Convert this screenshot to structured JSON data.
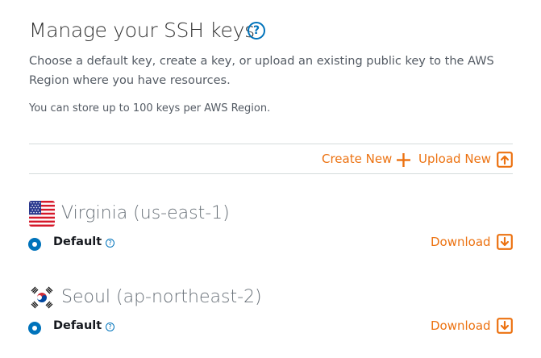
{
  "header": {
    "title": "Manage your SSH keys",
    "help_glyph": "?",
    "description": "Choose a default key, create a key, or upload an existing public key to the AWS Region where you have resources.",
    "note": "You can store up to 100 keys per AWS Region."
  },
  "actions": {
    "create_new_label": "Create New",
    "create_icon": "plus-icon",
    "upload_new_label": "Upload New",
    "upload_icon": "upload-icon"
  },
  "regions": [
    {
      "name": "Virginia (us-east-1)",
      "flag_icon": "us-flag-icon",
      "default_label": "Default",
      "default_selected": true,
      "help_glyph": "?",
      "download_label": "Download",
      "download_icon": "download-icon"
    },
    {
      "name": "Seoul (ap-northeast-2)",
      "flag_icon": "kr-flag-icon",
      "default_label": "Default",
      "default_selected": true,
      "help_glyph": "?",
      "download_label": "Download",
      "download_icon": "download-icon"
    }
  ],
  "colors": {
    "accent_orange": "#ec7211",
    "link_blue": "#0073bb",
    "divider": "#d5dbdb"
  }
}
